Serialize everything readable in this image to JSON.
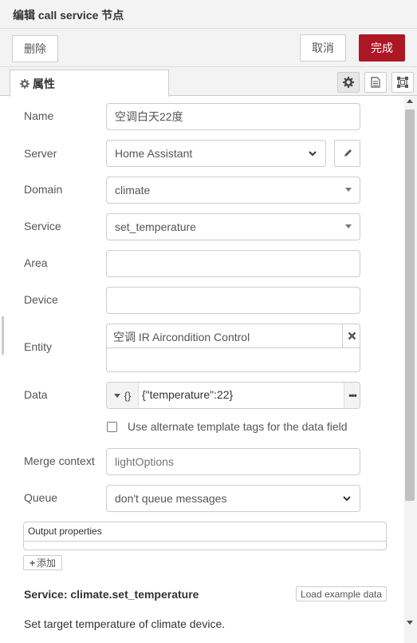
{
  "tray": {
    "title": "编辑 call service 节点"
  },
  "toolbar": {
    "delete_label": "删除",
    "cancel_label": "取消",
    "done_label": "完成"
  },
  "tabs": {
    "properties_label": "属性"
  },
  "fields": {
    "name": {
      "label": "Name",
      "value": "空调白天22度"
    },
    "server": {
      "label": "Server",
      "value": "Home Assistant"
    },
    "domain": {
      "label": "Domain",
      "value": "climate"
    },
    "service": {
      "label": "Service",
      "value": "set_temperature"
    },
    "area": {
      "label": "Area",
      "value": ""
    },
    "device": {
      "label": "Device",
      "value": ""
    },
    "entity": {
      "label": "Entity",
      "value": "空调 IR Aircondition Control"
    },
    "data": {
      "label": "Data",
      "type_icon": "{}",
      "value": "{\"temperature\":22}"
    },
    "alt_template": {
      "label": "Use alternate template tags for the data field",
      "checked": false
    },
    "merge_context": {
      "label": "Merge context",
      "placeholder": "lightOptions"
    },
    "queue": {
      "label": "Queue",
      "value": "don't queue messages"
    }
  },
  "output": {
    "header": "Output properties",
    "add_label": "添加"
  },
  "service_info": {
    "title": "Service: climate.set_temperature",
    "load_example_label": "Load example data",
    "description": "Set target temperature of climate device."
  },
  "colors": {
    "accent": "#ad1625"
  }
}
